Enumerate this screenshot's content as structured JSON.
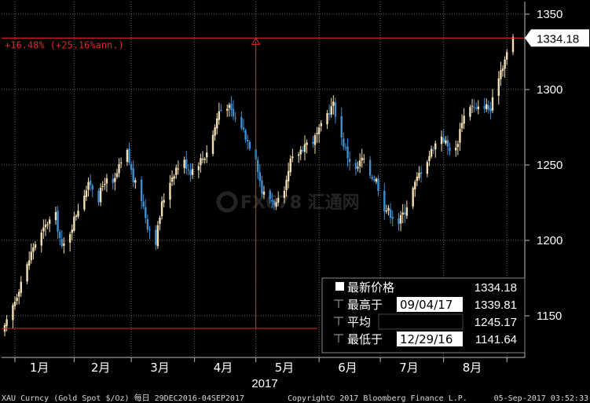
{
  "chart_data": {
    "type": "candlestick",
    "ylim": [
      1125,
      1360
    ],
    "y_ticks": [
      1150,
      1200,
      1250,
      1300,
      1350
    ],
    "x_range": [
      "2016-12-29",
      "2017-09-04"
    ],
    "x_ticks": [
      {
        "label": "1月",
        "date": "2017-01-15"
      },
      {
        "label": "2月",
        "date": "2017-02-14"
      },
      {
        "label": "3月",
        "date": "2017-03-15"
      },
      {
        "label": "4月",
        "date": "2017-04-15"
      },
      {
        "label": "5月",
        "date": "2017-05-15"
      },
      {
        "label": "6月",
        "date": "2017-06-15"
      },
      {
        "label": "7月",
        "date": "2017-07-15"
      },
      {
        "label": "8月",
        "date": "2017-08-15"
      }
    ],
    "year_label": "2017",
    "series": [
      {
        "points": [
          [
            "2016-12-29",
            1141.6
          ],
          [
            "2017-01-03",
            1160
          ],
          [
            "2017-01-06",
            1173
          ],
          [
            "2017-01-09",
            1183
          ],
          [
            "2017-01-12",
            1196
          ],
          [
            "2017-01-16",
            1204
          ],
          [
            "2017-01-19",
            1212
          ],
          [
            "2017-01-23",
            1216
          ],
          [
            "2017-01-26",
            1194
          ],
          [
            "2017-01-30",
            1206
          ],
          [
            "2017-02-02",
            1218
          ],
          [
            "2017-02-06",
            1232
          ],
          [
            "2017-02-09",
            1238
          ],
          [
            "2017-02-13",
            1228
          ],
          [
            "2017-02-16",
            1240
          ],
          [
            "2017-02-20",
            1236
          ],
          [
            "2017-02-23",
            1248
          ],
          [
            "2017-02-27",
            1258
          ],
          [
            "2017-03-02",
            1240
          ],
          [
            "2017-03-06",
            1228
          ],
          [
            "2017-03-09",
            1210
          ],
          [
            "2017-03-13",
            1200
          ],
          [
            "2017-03-16",
            1224
          ],
          [
            "2017-03-20",
            1240
          ],
          [
            "2017-03-23",
            1248
          ],
          [
            "2017-03-27",
            1252
          ],
          [
            "2017-03-30",
            1246
          ],
          [
            "2017-04-03",
            1252
          ],
          [
            "2017-04-06",
            1256
          ],
          [
            "2017-04-10",
            1270
          ],
          [
            "2017-04-13",
            1286
          ],
          [
            "2017-04-17",
            1290
          ],
          [
            "2017-04-20",
            1282
          ],
          [
            "2017-04-24",
            1276
          ],
          [
            "2017-04-27",
            1266
          ],
          [
            "2017-05-01",
            1256
          ],
          [
            "2017-05-04",
            1232
          ],
          [
            "2017-05-08",
            1228
          ],
          [
            "2017-05-11",
            1224
          ],
          [
            "2017-05-15",
            1230
          ],
          [
            "2017-05-18",
            1252
          ],
          [
            "2017-05-22",
            1258
          ],
          [
            "2017-05-25",
            1264
          ],
          [
            "2017-05-29",
            1266
          ],
          [
            "2017-06-01",
            1272
          ],
          [
            "2017-06-05",
            1284
          ],
          [
            "2017-06-08",
            1290
          ],
          [
            "2017-06-12",
            1268
          ],
          [
            "2017-06-15",
            1256
          ],
          [
            "2017-06-19",
            1246
          ],
          [
            "2017-06-22",
            1254
          ],
          [
            "2017-06-26",
            1244
          ],
          [
            "2017-06-29",
            1240
          ],
          [
            "2017-07-03",
            1222
          ],
          [
            "2017-07-06",
            1218
          ],
          [
            "2017-07-10",
            1212
          ],
          [
            "2017-07-13",
            1220
          ],
          [
            "2017-07-17",
            1234
          ],
          [
            "2017-07-20",
            1244
          ],
          [
            "2017-07-24",
            1254
          ],
          [
            "2017-07-27",
            1262
          ],
          [
            "2017-07-31",
            1270
          ],
          [
            "2017-08-03",
            1262
          ],
          [
            "2017-08-07",
            1260
          ],
          [
            "2017-08-10",
            1280
          ],
          [
            "2017-08-14",
            1290
          ],
          [
            "2017-08-17",
            1286
          ],
          [
            "2017-08-21",
            1290
          ],
          [
            "2017-08-24",
            1286
          ],
          [
            "2017-08-28",
            1310
          ],
          [
            "2017-08-31",
            1320
          ],
          [
            "2017-09-04",
            1334.18
          ]
        ]
      }
    ],
    "last_value_label": "1334.18",
    "annotation": {
      "text": "+16.48% (+25.16%ann.)",
      "low_value": 1141.64,
      "high_value": 1334.18,
      "arrow_date": "2017-05-01"
    },
    "legend": {
      "rows": [
        {
          "label": "最新价格",
          "date": "",
          "value": "1334.18"
        },
        {
          "label": "最高于",
          "date": "09/04/17",
          "value": "1339.81"
        },
        {
          "label": "平均",
          "date": "",
          "value": "1245.17"
        },
        {
          "label": "最低于",
          "date": "12/29/16",
          "value": "1141.64"
        }
      ],
      "placement": "bottom-right"
    },
    "colors": {
      "up": "#f3dfb3",
      "down": "#3d8fd1",
      "annotation": "#e3262a",
      "grid": "#666666",
      "background": "#000000"
    }
  },
  "footer": {
    "left": "XAU Curncy (Gold Spot  $/Oz)  每日 29DEC2016-04SEP2017",
    "center": "Copyright© 2017 Bloomberg Finance L.P.",
    "right": "05-Sep-2017 03:52:33"
  },
  "watermark": "FX678 汇通网"
}
